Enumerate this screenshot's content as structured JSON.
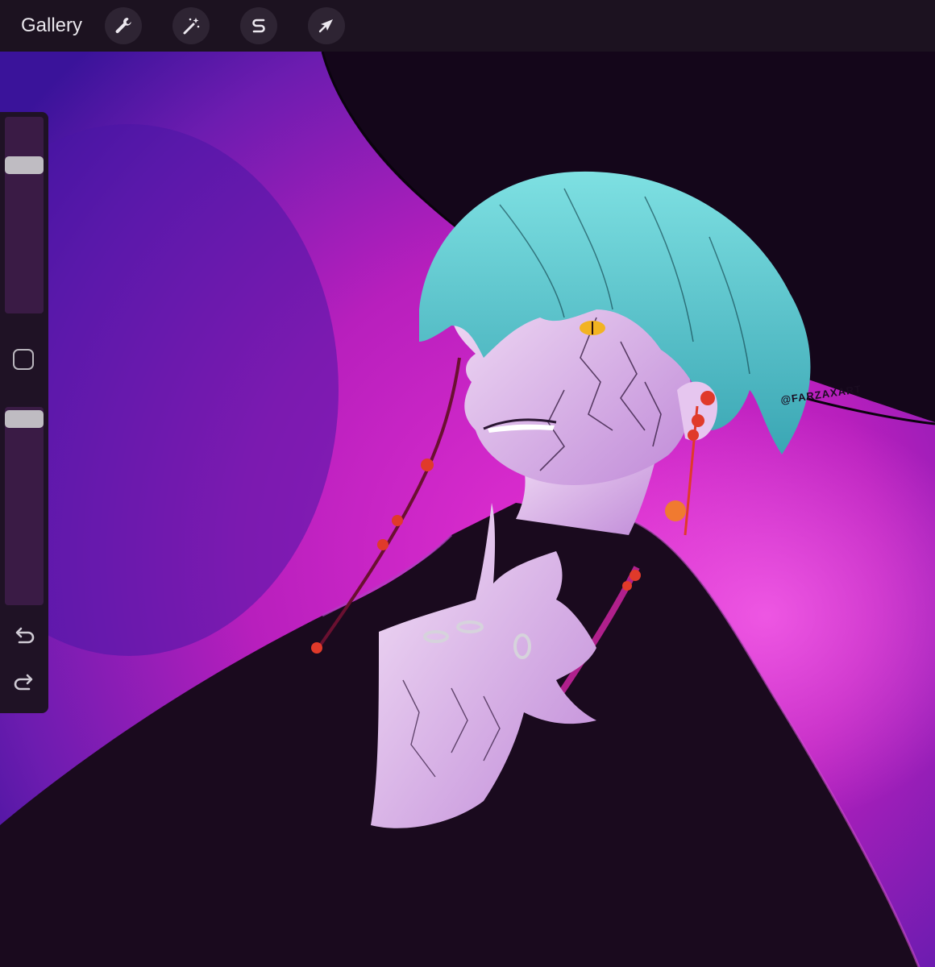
{
  "topbar": {
    "gallery_label": "Gallery",
    "tools": [
      {
        "name": "actions",
        "icon": "wrench-icon"
      },
      {
        "name": "adjustments",
        "icon": "magic-wand-icon"
      },
      {
        "name": "selection",
        "icon": "selection-s-icon"
      },
      {
        "name": "transform",
        "icon": "arrow-cursor-icon"
      }
    ]
  },
  "sidebar": {
    "brush_size_level": 0.78,
    "opacity_level": 0.98,
    "modify_button_icon": "square-icon",
    "undo_icon": "undo-icon",
    "redo_icon": "redo-icon"
  },
  "canvas": {
    "watermark": "@FARZAXART",
    "colors": {
      "background_magenta": "#c21fb8",
      "background_purple": "#5a1aa8",
      "hat": "#14061a",
      "hair": "#5fc7cc",
      "skin": "#e6c6ef",
      "coat": "#1a0a1e",
      "beads": "#e03a2a",
      "eye": "#f2b322"
    }
  }
}
